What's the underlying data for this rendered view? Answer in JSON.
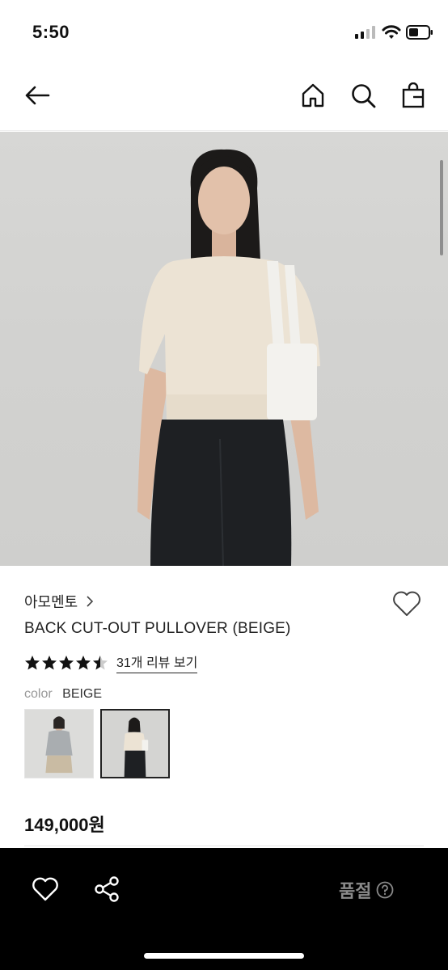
{
  "status_bar": {
    "time": "5:50"
  },
  "nav": {
    "back": "back-arrow-icon",
    "icons": [
      "home-icon",
      "search-icon",
      "shopping-bag-icon"
    ]
  },
  "product": {
    "brand": "아모멘토",
    "title": "BACK CUT-OUT PULLOVER (BEIGE)",
    "rating": 4.5,
    "review_link": "31개 리뷰 보기",
    "color_label": "color",
    "color_value": "BEIGE",
    "swatches": [
      "gray",
      "beige"
    ],
    "selected_swatch": "beige",
    "price": "149,000원"
  },
  "bottom_bar": {
    "soldout_label": "품절",
    "icons": [
      "heart-icon",
      "share-icon",
      "help-icon"
    ]
  },
  "colors": {
    "bottom_bar": "#000000",
    "soldout_text": "#8a8a8a",
    "image_bg": "#d4d4d2"
  }
}
